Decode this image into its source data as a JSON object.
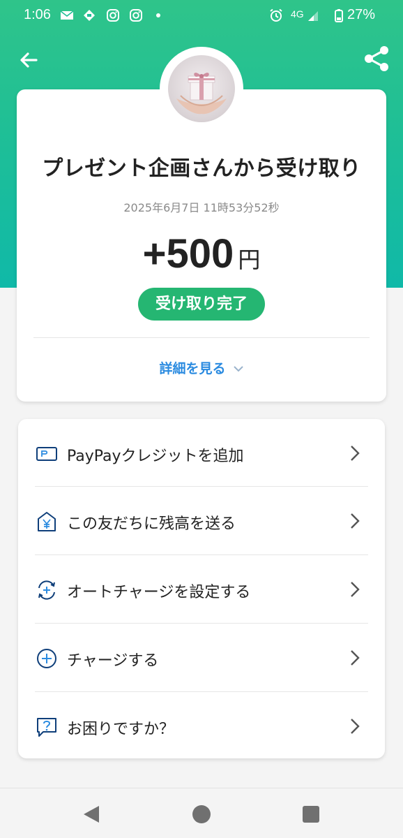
{
  "status_bar": {
    "time": "1:06",
    "network": "4G",
    "battery": "27%",
    "icons": [
      "mail-icon",
      "notification-icon",
      "instagram-icon",
      "instagram-icon",
      "alarm-icon",
      "signal-icon",
      "battery-icon"
    ]
  },
  "header": {
    "back_icon": "arrow-left-icon",
    "share_icon": "share-icon",
    "colors": {
      "gradient_top": "#2fc48a",
      "gradient_bottom": "#10b9a8"
    }
  },
  "transaction": {
    "title": "プレゼント企画さんから受け取り",
    "datetime": "2025年6月7日 11時53分52秒",
    "amount": "+500",
    "currency": "円",
    "status": "受け取り完了",
    "status_color": "#25b672",
    "details_label": "詳細を見る"
  },
  "menu": {
    "items": [
      {
        "label": "PayPayクレジットを追加",
        "icon": "credit-card-icon"
      },
      {
        "label": "この友だちに残高を送る",
        "icon": "send-yen-icon"
      },
      {
        "label": "オートチャージを設定する",
        "icon": "auto-charge-icon"
      },
      {
        "label": "チャージする",
        "icon": "plus-circle-icon"
      },
      {
        "label": "お困りですか？",
        "icon": "help-chat-icon"
      }
    ]
  },
  "nav": {
    "icons": [
      "back-triangle-icon",
      "home-circle-icon",
      "recents-square-icon"
    ]
  }
}
